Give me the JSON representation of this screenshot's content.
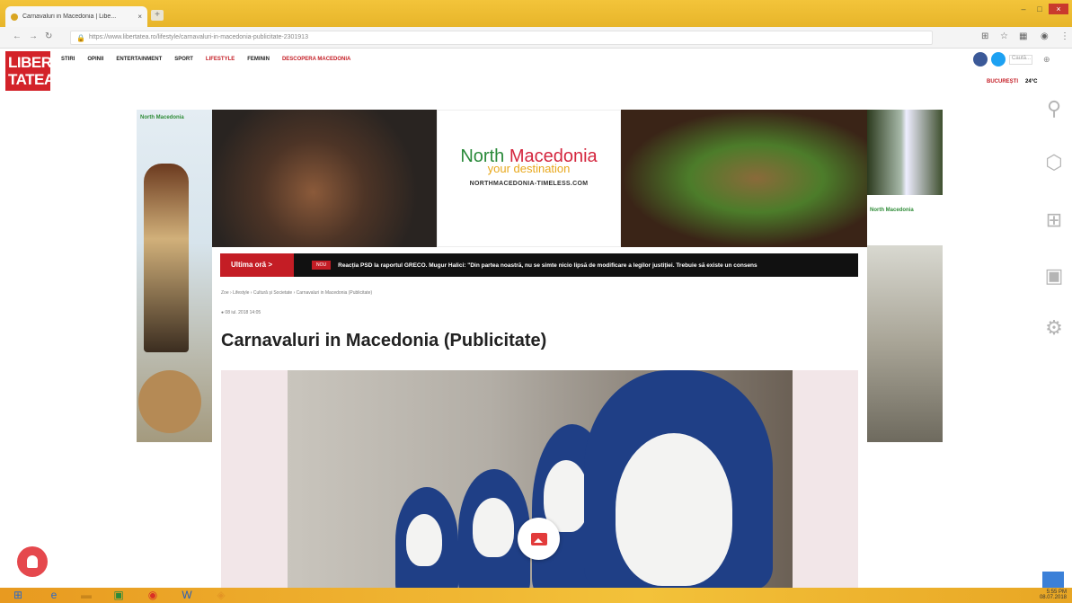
{
  "browser": {
    "tab_title": "Carnavaluri in Macedonia | Libe...",
    "tab_close": "×",
    "new_tab": "+",
    "url": "https://www.libertatea.ro/lifestyle/carnavaluri-in-macedonia-publicitate-2301913",
    "window_buttons": [
      "–",
      "□",
      "×"
    ]
  },
  "site": {
    "logo_line1": "LIBER",
    "logo_line2": "TATEA",
    "nav": [
      "STIRI",
      "OPINII",
      "ENTERTAINMENT",
      "SPORT",
      "LIFESTYLE",
      "FEMININ",
      "DESCOPERA MACEDONIA"
    ],
    "search_placeholder": "Caută...",
    "city": "BUCUREȘTI",
    "temperature": "24°C"
  },
  "ads": {
    "left_brand": "North Macedonia",
    "center_title_a": "North ",
    "center_title_b": "Macedonia",
    "center_tagline": "your destination",
    "center_url": "NORTHMACEDONIA-TIMELESS.COM",
    "right_brand": "North Macedonia"
  },
  "breaking": {
    "label": "Ultima oră >",
    "tag": "NOU",
    "text": "Reacția PSD la raportul GRECO. Mugur Halici: \"Din partea noastră, nu se simte nicio lipsă de modificare a legilor justiției. Trebuie să existe un consens"
  },
  "article": {
    "breadcrumb": "Zoe › Lifestyle › Cultură și Societate › Carnavaluri in Macedonia (Publicitate)",
    "date": "● 08 iul. 2018 14:05",
    "title": "Carnavaluri in Macedonia (Publicitate)"
  },
  "taskbar": {
    "time": "5:55 PM",
    "date": "08.07.2018"
  },
  "colors": {
    "brand_red": "#c41d25",
    "chrome_yellow": "#f3c43a"
  }
}
